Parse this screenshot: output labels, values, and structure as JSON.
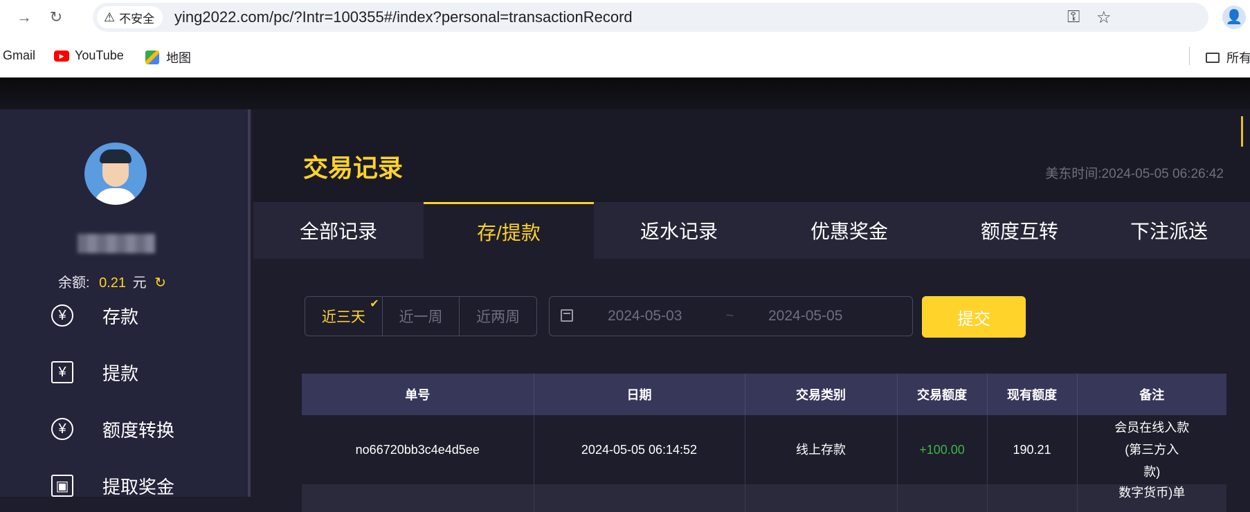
{
  "browser": {
    "security_label": "不安全",
    "url": "ying2022.com/pc/?Intr=100355#/index?personal=transactionRecord",
    "bookmarks": [
      "Gmail",
      "YouTube",
      "地图"
    ],
    "all_bookmarks": "所有"
  },
  "sidebar": {
    "balance_label": "余额:",
    "balance_value": "0.21",
    "balance_unit": "元",
    "menu": [
      {
        "label": "存款",
        "icon": "yen-circle-icon"
      },
      {
        "label": "提款",
        "icon": "ticket-icon"
      },
      {
        "label": "额度转换",
        "icon": "exchange-icon"
      },
      {
        "label": "提取奖金",
        "icon": "gift-icon"
      }
    ]
  },
  "main": {
    "title": "交易记录",
    "timestamp": "美东时间:2024-05-05 06:26:42",
    "tabs": [
      "全部记录",
      "存/提款",
      "返水记录",
      "优惠奖金",
      "额度互转",
      "下注派送"
    ],
    "active_tab": "存/提款",
    "filters": [
      "近三天",
      "近一周",
      "近两周"
    ],
    "active_filter": "近三天",
    "date_start": "2024-05-03",
    "date_separator": "~",
    "date_end": "2024-05-05",
    "submit_label": "提交"
  },
  "table": {
    "headers": [
      "单号",
      "日期",
      "交易类别",
      "交易额度",
      "现有额度",
      "备注"
    ],
    "rows": [
      {
        "order_no": "no66720bb3c4e4d5ee",
        "date": "2024-05-05 06:14:52",
        "type": "线上存款",
        "amount": "+100.00",
        "balance": "190.21",
        "remark_line1": "会员在线入款",
        "remark_line2": "(第三方入",
        "remark_line3": "款)"
      },
      {
        "remark_partial": "数字货币)单"
      }
    ]
  },
  "colors": {
    "accent": "#ffd32a",
    "positive": "#3bb54a",
    "sidebar_bg": "#24243a",
    "table_header_bg": "#37375a"
  }
}
